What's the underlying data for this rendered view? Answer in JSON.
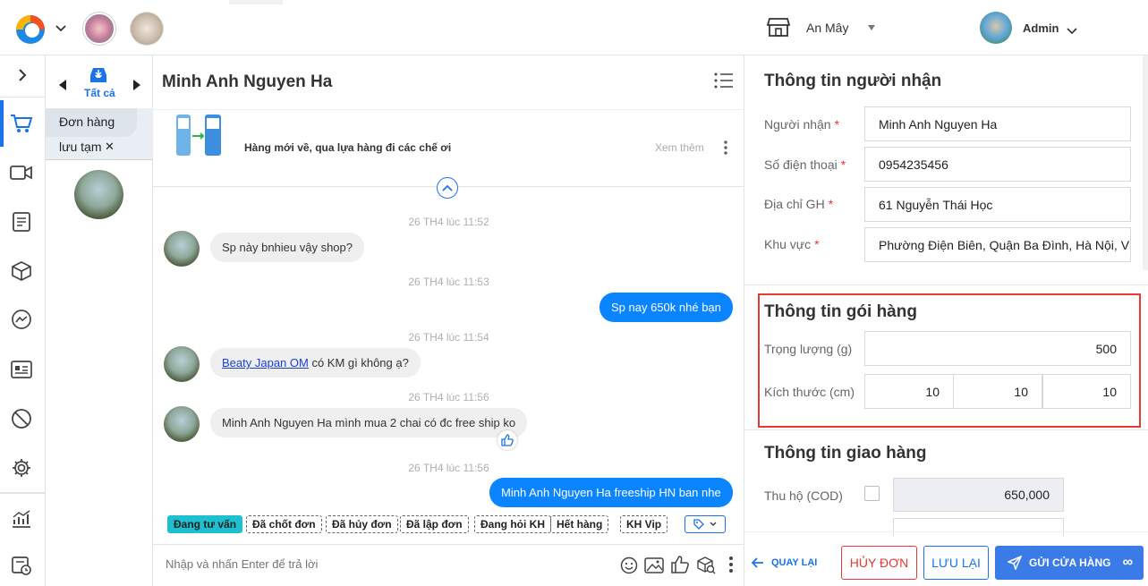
{
  "topbar": {
    "shop_name": "An Mây",
    "user_name": "Admin"
  },
  "column2": {
    "filter_label": "Tất cả",
    "draft_line1": "Đơn hàng",
    "draft_line2": "lưu tạm",
    "draft_close": "✕"
  },
  "chat": {
    "contact_name": "Minh Anh Nguyen Ha",
    "pinned_text": "Hàng mới về, qua lựa hàng đi các chế ơi",
    "see_more": "Xem thêm",
    "messages": [
      {
        "time": "26 TH4 lúc 11:52",
        "text": "Sp này bnhieu vậy shop?"
      },
      {
        "time": "26 TH4 lúc 11:53",
        "text": "Sp nay 650k nhé bạn"
      },
      {
        "time": "26 TH4 lúc 11:54",
        "link": "Beaty Japan OM",
        "text": " có KM gì không ạ?"
      },
      {
        "time": "26 TH4 lúc 11:56",
        "text": "Minh Anh Nguyen Ha mình mua 2 chai có đc free ship ko"
      },
      {
        "time": "26 TH4 lúc 11:56",
        "text": "Minh Anh Nguyen Ha freeship HN ban nhe"
      }
    ],
    "tags": [
      "Đang tư vấn",
      "Đã chốt đơn",
      "Đã hủy đơn",
      "Đã lập đơn",
      "Đang hỏi KH",
      "Hết hàng",
      "KH Vip"
    ],
    "input_placeholder": "Nhập và nhấn Enter để trả lời"
  },
  "recipient": {
    "title": "Thông tin người nhận",
    "name_label": "Người nhận",
    "name_value": "Minh Anh Nguyen Ha",
    "phone_label": "Số điện thoại",
    "phone_value": "0954235456",
    "address_label": "Địa chỉ GH",
    "address_value": "61 Nguyễn Thái Học",
    "area_label": "Khu vực",
    "area_value": "Phường Điện Biên, Quận Ba Đình, Hà Nội, V",
    "required_mark": "*"
  },
  "package": {
    "title": "Thông tin gói hàng",
    "weight_label": "Trọng lượng (g)",
    "weight_value": "500",
    "size_label": "Kích thước (cm)",
    "length": "10",
    "width": "10",
    "height": "10"
  },
  "shipping": {
    "title": "Thông tin giao hàng",
    "cod_label": "Thu hộ (COD)",
    "cod_value": "650,000"
  },
  "actions": {
    "back": "QUAY LẠI",
    "cancel": "HỦY ĐƠN",
    "save": "LƯU LẠI",
    "send": "GỬI CỬA HÀNG",
    "more": "∞"
  },
  "colors": {
    "primary": "#1a73e8",
    "bubble_blue": "#0a84ff",
    "danger": "#e53935",
    "highlight_box": "#e53935",
    "tag_active": "#1ec0d0"
  }
}
